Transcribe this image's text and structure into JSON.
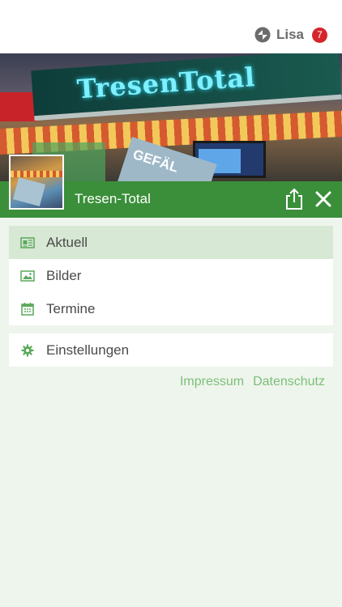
{
  "user": {
    "name": "Lisa",
    "notification_count": "7"
  },
  "hero": {
    "sign_text": "TresenTotal",
    "card_text": "GEFÄL"
  },
  "titlebar": {
    "title": "Tresen-Total"
  },
  "menu": {
    "items": [
      {
        "label": "Aktuell",
        "icon": "newspaper-icon",
        "active": true
      },
      {
        "label": "Bilder",
        "icon": "image-icon",
        "active": false
      },
      {
        "label": "Termine",
        "icon": "calendar-icon",
        "active": false
      }
    ]
  },
  "settings": {
    "label": "Einstellungen",
    "icon": "gear-icon"
  },
  "footer": {
    "impressum": "Impressum",
    "datenschutz": "Datenschutz"
  },
  "colors": {
    "green": "#3b8f3a",
    "icon_green": "#5aa85a",
    "badge_red": "#d6242b",
    "link_green": "#7cbf79",
    "active_bg": "#d7e8d4",
    "page_bg": "#eef5ec"
  }
}
